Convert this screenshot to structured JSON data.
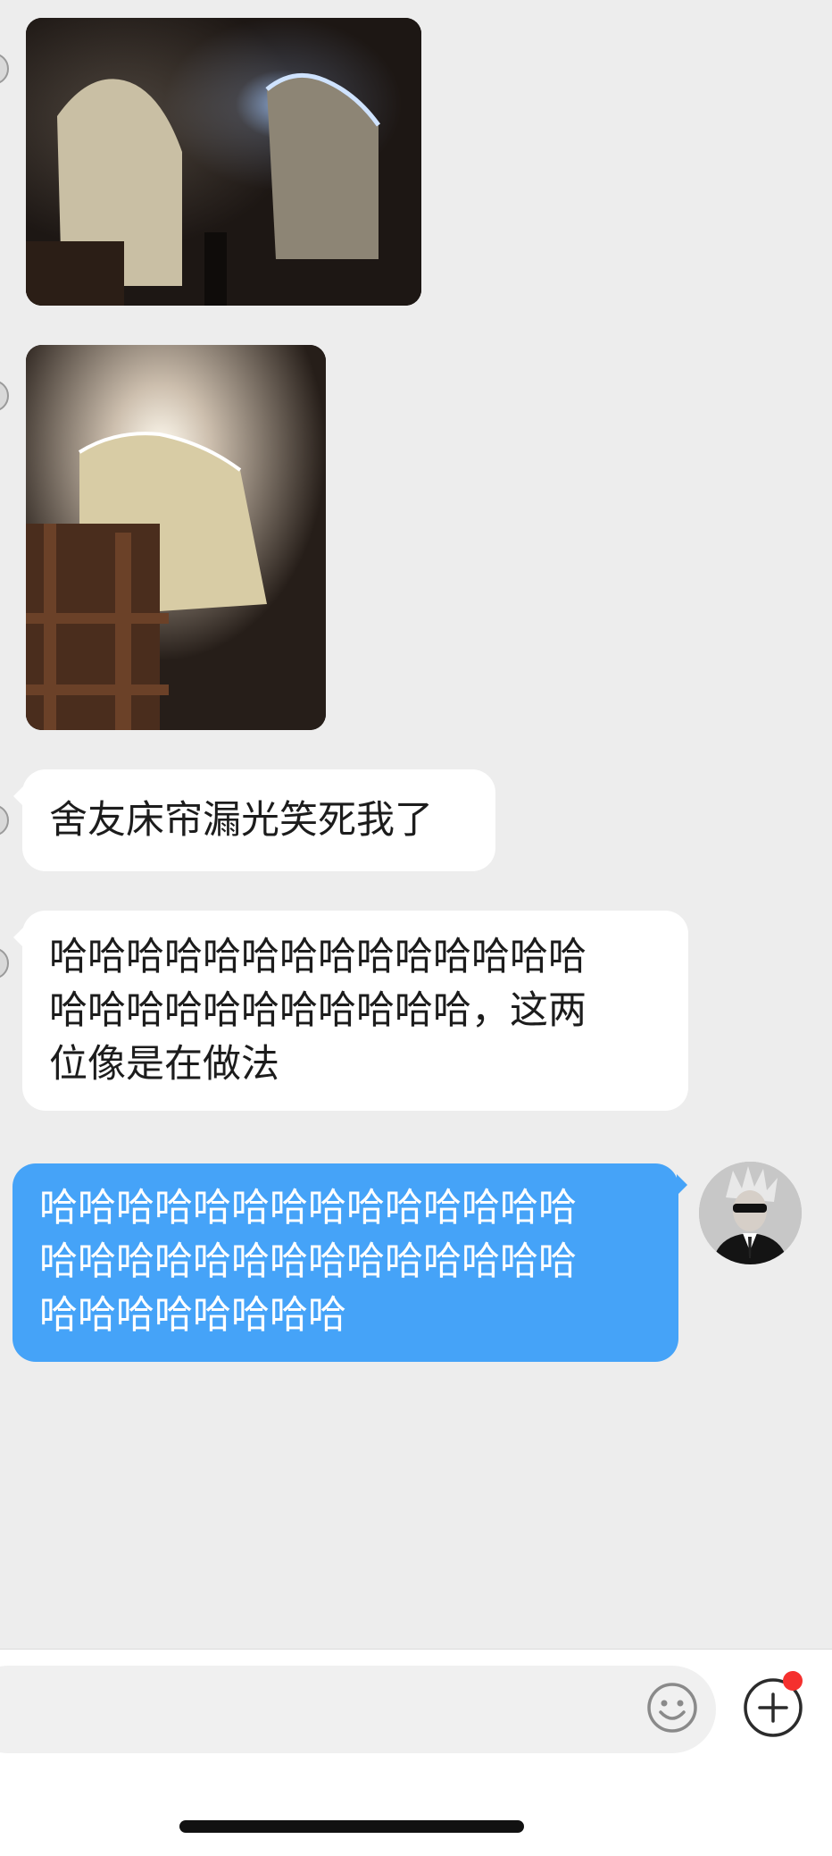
{
  "messages": {
    "photo_1": {
      "icon": "photo-bed-curtain-glow"
    },
    "photo_2": {
      "icon": "photo-bed-curtain-glow"
    },
    "incoming_1": {
      "lines": [
        "舍友床帘漏光笑死我了"
      ]
    },
    "incoming_2": {
      "lines": [
        "哈哈哈哈哈哈哈哈哈哈哈哈哈哈",
        "哈哈哈哈哈哈哈哈哈哈哈，这两",
        "位像是在做法"
      ]
    },
    "outgoing_1": {
      "lines": [
        "哈哈哈哈哈哈哈哈哈哈哈哈哈哈",
        "哈哈哈哈哈哈哈哈哈哈哈哈哈哈",
        "哈哈哈哈哈哈哈哈"
      ]
    }
  },
  "input_bar": {
    "emoji_icon": "smiley-icon",
    "plus_icon": "plus-circle-icon"
  },
  "colors": {
    "background": "#ededed",
    "incoming_bubble": "#ffffff",
    "outgoing_bubble": "#45a3f8",
    "badge": "#f5302e"
  }
}
